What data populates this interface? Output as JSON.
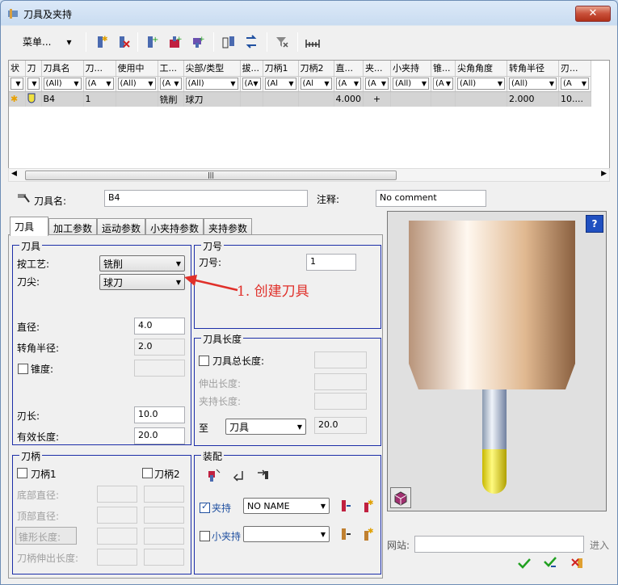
{
  "window": {
    "title": "刀具及夹持",
    "close": "✕"
  },
  "toolbar": {
    "menu_label": "菜单..."
  },
  "grid": {
    "headers": [
      "状",
      "刀",
      "刀具名",
      "刀...",
      "使用中",
      "工...",
      "尖部/类型",
      "拔...",
      "刀柄1",
      "刀柄2",
      "直...",
      "夹...",
      "小夹持",
      "锥...",
      "尖角角度",
      "转角半径",
      "刃..."
    ],
    "filters": [
      "",
      "",
      "(All)",
      "(A",
      "(All)",
      "(A",
      "(All)",
      "(A",
      "(Al",
      "(Al",
      "(A",
      "(A",
      "(All)",
      "(A",
      "(All)",
      "(All)",
      "(A"
    ],
    "rows": [
      [
        "",
        "",
        "B4",
        "1",
        "",
        "铣削",
        "球刀",
        "",
        "",
        "",
        "4.000",
        "+",
        "",
        "",
        "",
        "2.000",
        "10...."
      ]
    ]
  },
  "fields": {
    "tool_name_label": "刀具名:",
    "tool_name": "B4",
    "comment_label": "注释:",
    "comment": "No comment"
  },
  "tabs": [
    "刀具",
    "加工参数",
    "运动参数",
    "小夹持参数",
    "夹持参数"
  ],
  "tool_group": {
    "title": "刀具",
    "process_label": "按工艺:",
    "process": "铣削",
    "tip_label": "刀尖:",
    "tip": "球刀",
    "diameter_label": "直径:",
    "diameter": "4.0",
    "corner_label": "转角半径:",
    "corner": "2.0",
    "taper_label": "锥度:",
    "flute_label": "刃长:",
    "flute": "10.0",
    "eff_label": "有效长度:",
    "eff": "20.0"
  },
  "number_group": {
    "title": "刀号",
    "num_label": "刀号:",
    "num": "1"
  },
  "length_group": {
    "title": "刀具长度",
    "total_label": "刀具总长度:",
    "overhang_label": "伸出长度:",
    "clamp_label": "夹持长度:",
    "to_label": "至",
    "to_value": "刀具",
    "to_num": "20.0"
  },
  "shank_group": {
    "title": "刀柄",
    "shank1": "刀柄1",
    "shank2": "刀柄2",
    "bottom_label": "底部直径:",
    "top_label": "顶部直径:",
    "taper_label": "锥形长度:",
    "overhang_label": "刀柄伸出长度:"
  },
  "assembly_group": {
    "title": "装配",
    "holder_label": "夹持",
    "holder_value": "NO NAME",
    "small_label": "小夹持"
  },
  "annotation": "1. 创建刀具",
  "bottom": {
    "site_label": "网站:",
    "import_label": "进入"
  },
  "colors": {
    "arrow": "#e0302a",
    "group_border": "#1c2ea8",
    "tool_tip": "#f0e040"
  }
}
